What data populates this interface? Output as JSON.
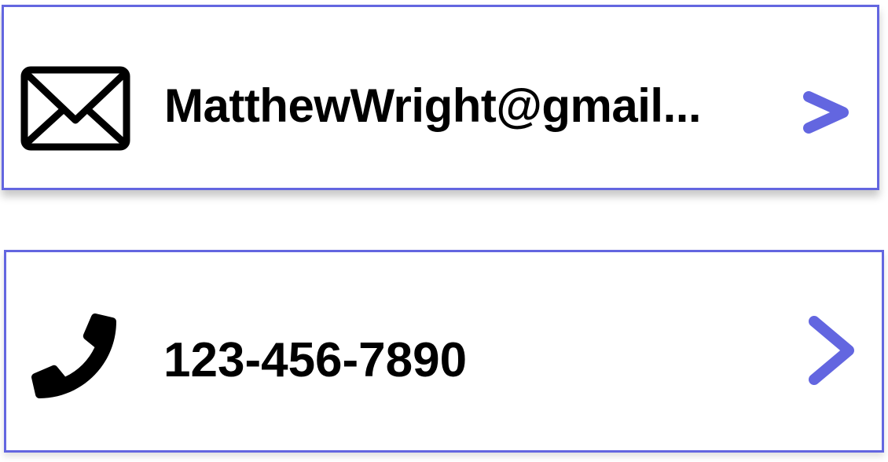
{
  "theme": {
    "accent": "#6366e0",
    "text": "#000000",
    "background": "#ffffff"
  },
  "contacts": [
    {
      "type": "email",
      "icon": "mail-icon",
      "value": "MatthewWright@gmail...",
      "action_icon": "chevron-right-icon"
    },
    {
      "type": "phone",
      "icon": "phone-icon",
      "value": "123-456-7890",
      "action_icon": "chevron-right-icon"
    }
  ]
}
